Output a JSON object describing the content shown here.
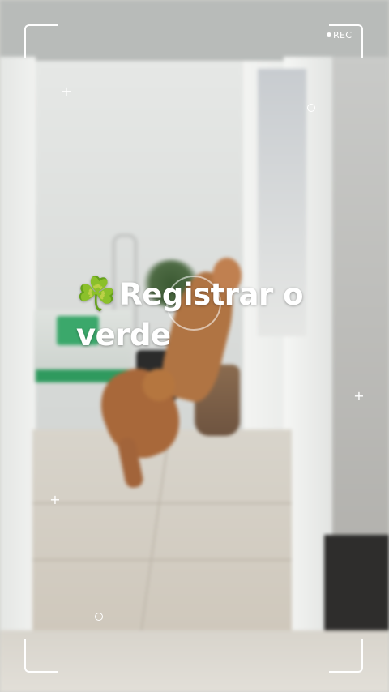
{
  "overlay": {
    "rec_label": "REC",
    "headline_emoji": "☘️",
    "headline_text": "Registrar o verde"
  },
  "icons": {
    "rec_dot": "record-dot-icon",
    "plus_markers": "plus-icon",
    "ring_markers": "ring-icon",
    "focus_circle": "focus-circle-icon"
  },
  "colors": {
    "overlay_white": "#ffffff",
    "wall": "#d9dcd9",
    "floor": "#d8d2c7",
    "dog": "#b06f3d",
    "basin_green": "#2f9a5e",
    "door_frame": "#eef0ee"
  }
}
